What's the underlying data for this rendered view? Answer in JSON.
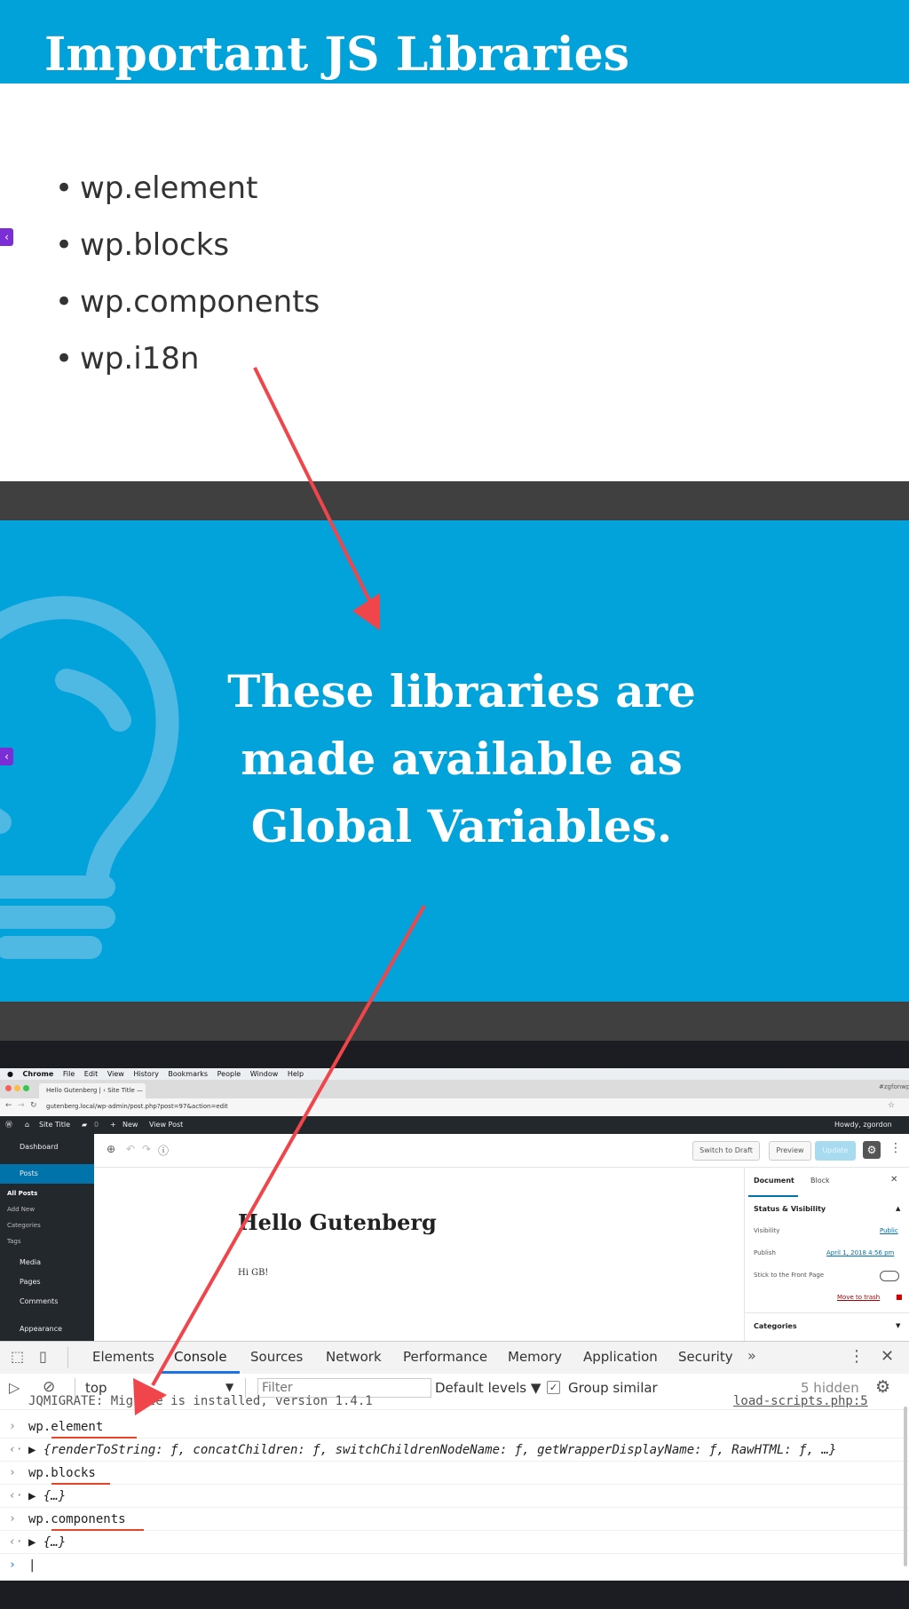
{
  "slide1": {
    "title": "Important JS Libraries",
    "bullets": [
      "wp.element",
      "wp.blocks",
      "wp.components",
      "wp.i18n"
    ],
    "side_tab_icon": "chevron-left-icon"
  },
  "slide2": {
    "text_lines": [
      "These libraries are",
      "made available as",
      "Global Variables."
    ],
    "background_icon": "lightbulb-icon"
  },
  "mac_menubar": {
    "items": [
      "Chrome",
      "File",
      "Edit",
      "View",
      "History",
      "Bookmarks",
      "People",
      "Window",
      "Help"
    ]
  },
  "browser": {
    "tab_title": "Hello Gutenberg | ‹ Site Title —",
    "profile": "#zgfonwp",
    "url": "gutenberg.local/wp-admin/post.php?post=97&action=edit"
  },
  "wp_adminbar": {
    "site_title": "Site Title",
    "comments_count": "0",
    "new_label": "New",
    "view_post": "View Post",
    "howdy": "Howdy, zgordon"
  },
  "wp_sidebar": {
    "items": [
      {
        "label": "Dashboard"
      },
      {
        "label": "Posts"
      },
      {
        "label": "Media"
      },
      {
        "label": "Pages"
      },
      {
        "label": "Comments"
      },
      {
        "label": "Appearance"
      }
    ],
    "posts_submenu": [
      "All Posts",
      "Add New",
      "Categories",
      "Tags"
    ]
  },
  "wp_toolbar": {
    "switch_to_draft": "Switch to Draft",
    "preview": "Preview",
    "update": "Update"
  },
  "wp_editor": {
    "post_title": "Hello Gutenberg",
    "post_body": "Hi GB!"
  },
  "wp_panel": {
    "tab_document": "Document",
    "tab_block": "Block",
    "section_title": "Status & Visibility",
    "visibility_label": "Visibility",
    "visibility_value": "Public",
    "publish_label": "Publish",
    "publish_value": "April 1, 2018 4:56 pm",
    "sticky_label": "Stick to the Front Page",
    "move_to_trash": "Move to trash",
    "categories": "Categories"
  },
  "devtools": {
    "tabs": [
      "Elements",
      "Console",
      "Sources",
      "Network",
      "Performance",
      "Memory",
      "Application",
      "Security"
    ],
    "active_tab": "Console",
    "context": "top",
    "filter_placeholder": "Filter",
    "levels": "Default levels",
    "group_similar": "Group similar",
    "hidden_count": "5 hidden",
    "partial_line": "JQMIGRATE: Migrate is installed, version 1.4.1",
    "partial_link": "load-scripts.php:5",
    "console_lines": [
      {
        "type": "input",
        "text": "wp.element"
      },
      {
        "type": "output",
        "text": "▶ {renderToString: ƒ, concatChildren: ƒ, switchChildrenNodeName: ƒ, getWrapperDisplayName: ƒ, RawHTML: ƒ, …}"
      },
      {
        "type": "input",
        "text": "wp.blocks"
      },
      {
        "type": "output",
        "text": "▶ {…}"
      },
      {
        "type": "input",
        "text": "wp.components"
      },
      {
        "type": "output",
        "text": "▶ {…}"
      }
    ],
    "cursor_prompt": "|"
  },
  "colors": {
    "slide_blue": "#00a2d9",
    "arrow_red": "#f0454a",
    "wp_dark": "#23282d",
    "wp_blue": "#0073aa",
    "underline_red": "#e4452b"
  }
}
